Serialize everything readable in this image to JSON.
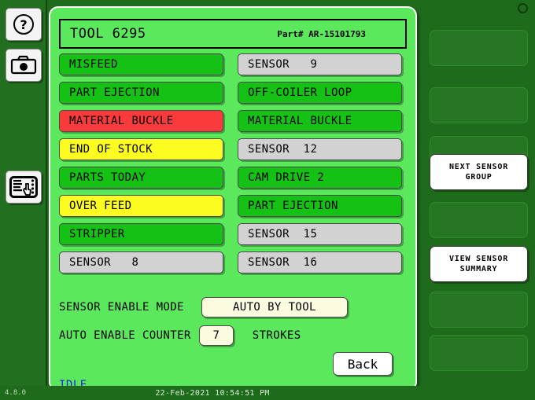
{
  "left_rail": {
    "buttons": [
      {
        "name": "help-button",
        "icon": "question-mark-icon"
      },
      {
        "name": "camera-button",
        "icon": "camera-icon"
      },
      {
        "name": "hmi-panel-button",
        "icon": "touch-panel-icon"
      }
    ]
  },
  "header": {
    "tool_label": "TOOL 6295",
    "part_label": "Part# AR-15101793"
  },
  "sensors": [
    {
      "label": "MISFEED",
      "state": "green"
    },
    {
      "label": "SENSOR   9",
      "state": "grey"
    },
    {
      "label": "PART EJECTION",
      "state": "green"
    },
    {
      "label": "OFF-COILER LOOP",
      "state": "green"
    },
    {
      "label": "MATERIAL BUCKLE",
      "state": "red"
    },
    {
      "label": "MATERIAL BUCKLE",
      "state": "green"
    },
    {
      "label": "END OF STOCK",
      "state": "yellow"
    },
    {
      "label": "SENSOR  12",
      "state": "grey"
    },
    {
      "label": "PARTS TODAY",
      "state": "green"
    },
    {
      "label": "CAM DRIVE 2",
      "state": "green"
    },
    {
      "label": "OVER FEED",
      "state": "yellow"
    },
    {
      "label": "PART EJECTION",
      "state": "green"
    },
    {
      "label": "STRIPPER",
      "state": "green"
    },
    {
      "label": "SENSOR  15",
      "state": "grey"
    },
    {
      "label": "SENSOR   8",
      "state": "grey"
    },
    {
      "label": "SENSOR  16",
      "state": "grey"
    }
  ],
  "controls": {
    "mode_label": "SENSOR ENABLE MODE",
    "mode_value": "AUTO BY TOOL",
    "counter_label": "AUTO ENABLE COUNTER",
    "counter_value": "7",
    "counter_units": "STROKES",
    "back_label": "Back"
  },
  "machine_status": "IDLE",
  "right_rail": {
    "slots": [
      {
        "label": "",
        "active": false
      },
      {
        "label": "",
        "active": false
      },
      {
        "label": "",
        "active": false
      },
      {
        "label": "NEXT SENSOR\nGROUP",
        "active": true
      },
      {
        "label": "",
        "active": false
      },
      {
        "label": "VIEW SENSOR\nSUMMARY",
        "active": true
      },
      {
        "label": "",
        "active": false
      },
      {
        "label": "",
        "active": false
      }
    ]
  },
  "status_bar": {
    "version": "4.8.0",
    "datetime": "22-Feb-2021 10:54:51 PM"
  },
  "colors": {
    "panel_green": "#5ce85c",
    "chassis_green": "#1f6b1c",
    "state_green": "#14c114",
    "state_red": "#fb3b3b",
    "state_yellow": "#fcfc20",
    "state_grey": "#d2d2d2",
    "field_cream": "#fbfbdf",
    "status_blue": "#2222dd"
  }
}
